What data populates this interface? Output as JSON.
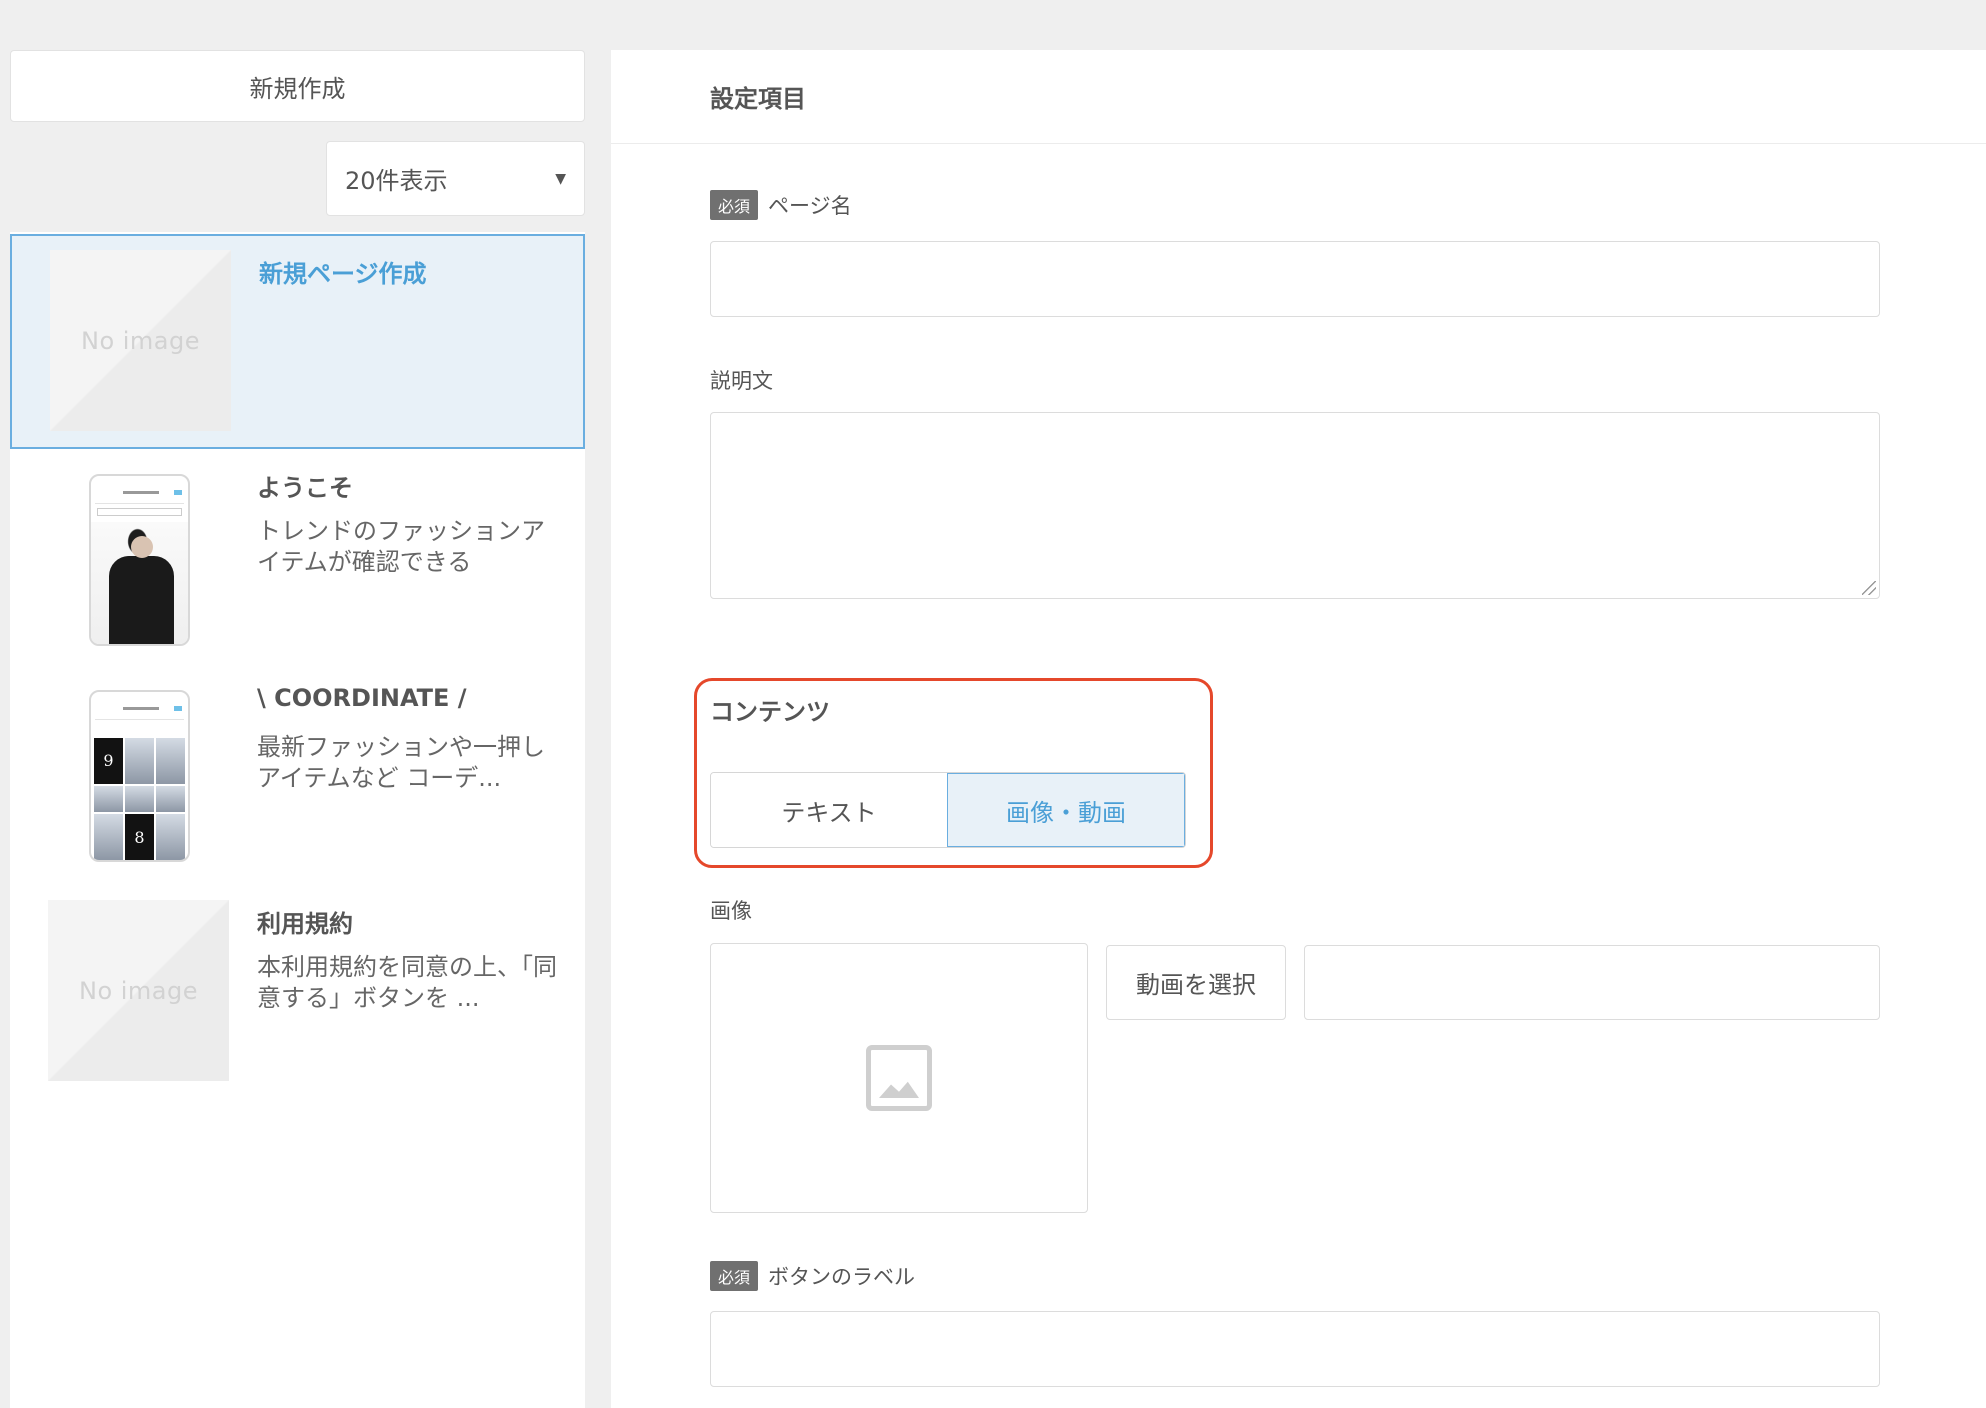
{
  "sidebar": {
    "new_button_label": "新規作成",
    "count_select": {
      "selected": "20件表示"
    },
    "no_image_text": "No image",
    "pages": [
      {
        "title": "新規ページ作成",
        "description": "",
        "thumbnail": "no-image",
        "selected": true
      },
      {
        "title": "ようこそ",
        "description": "トレンドのファッションアイテムが確認できる",
        "thumbnail": "phone-screenshot",
        "selected": false
      },
      {
        "title": "\\ COORDINATE /",
        "description": "最新ファッションや一押しアイテムなど コーデ...",
        "thumbnail": "phone-screenshot",
        "selected": false
      },
      {
        "title": "利用規約",
        "description": "本利用規約を同意の上、「同意する」ボタンを ...",
        "thumbnail": "no-image",
        "selected": false
      }
    ],
    "phone_grid_numbers": [
      "9",
      "8"
    ]
  },
  "settings": {
    "header": "設定項目",
    "required_badge": "必須",
    "page_name": {
      "label": "ページ名",
      "value": "",
      "required": true
    },
    "description": {
      "label": "説明文",
      "value": ""
    },
    "contents": {
      "title": "コンテンツ",
      "options": [
        "テキスト",
        "画像・動画"
      ],
      "selected": "画像・動画"
    },
    "image": {
      "label": "画像",
      "icon": "image-placeholder-icon"
    },
    "video": {
      "button_label": "動画を選択",
      "value": ""
    },
    "button_label_field": {
      "label": "ボタンのラベル",
      "value": "",
      "required": true
    }
  },
  "colors": {
    "accent_blue": "#4a9fd6",
    "selected_bg": "#e8f1f8",
    "highlight_red": "#e5482b",
    "badge_gray": "#707070"
  }
}
